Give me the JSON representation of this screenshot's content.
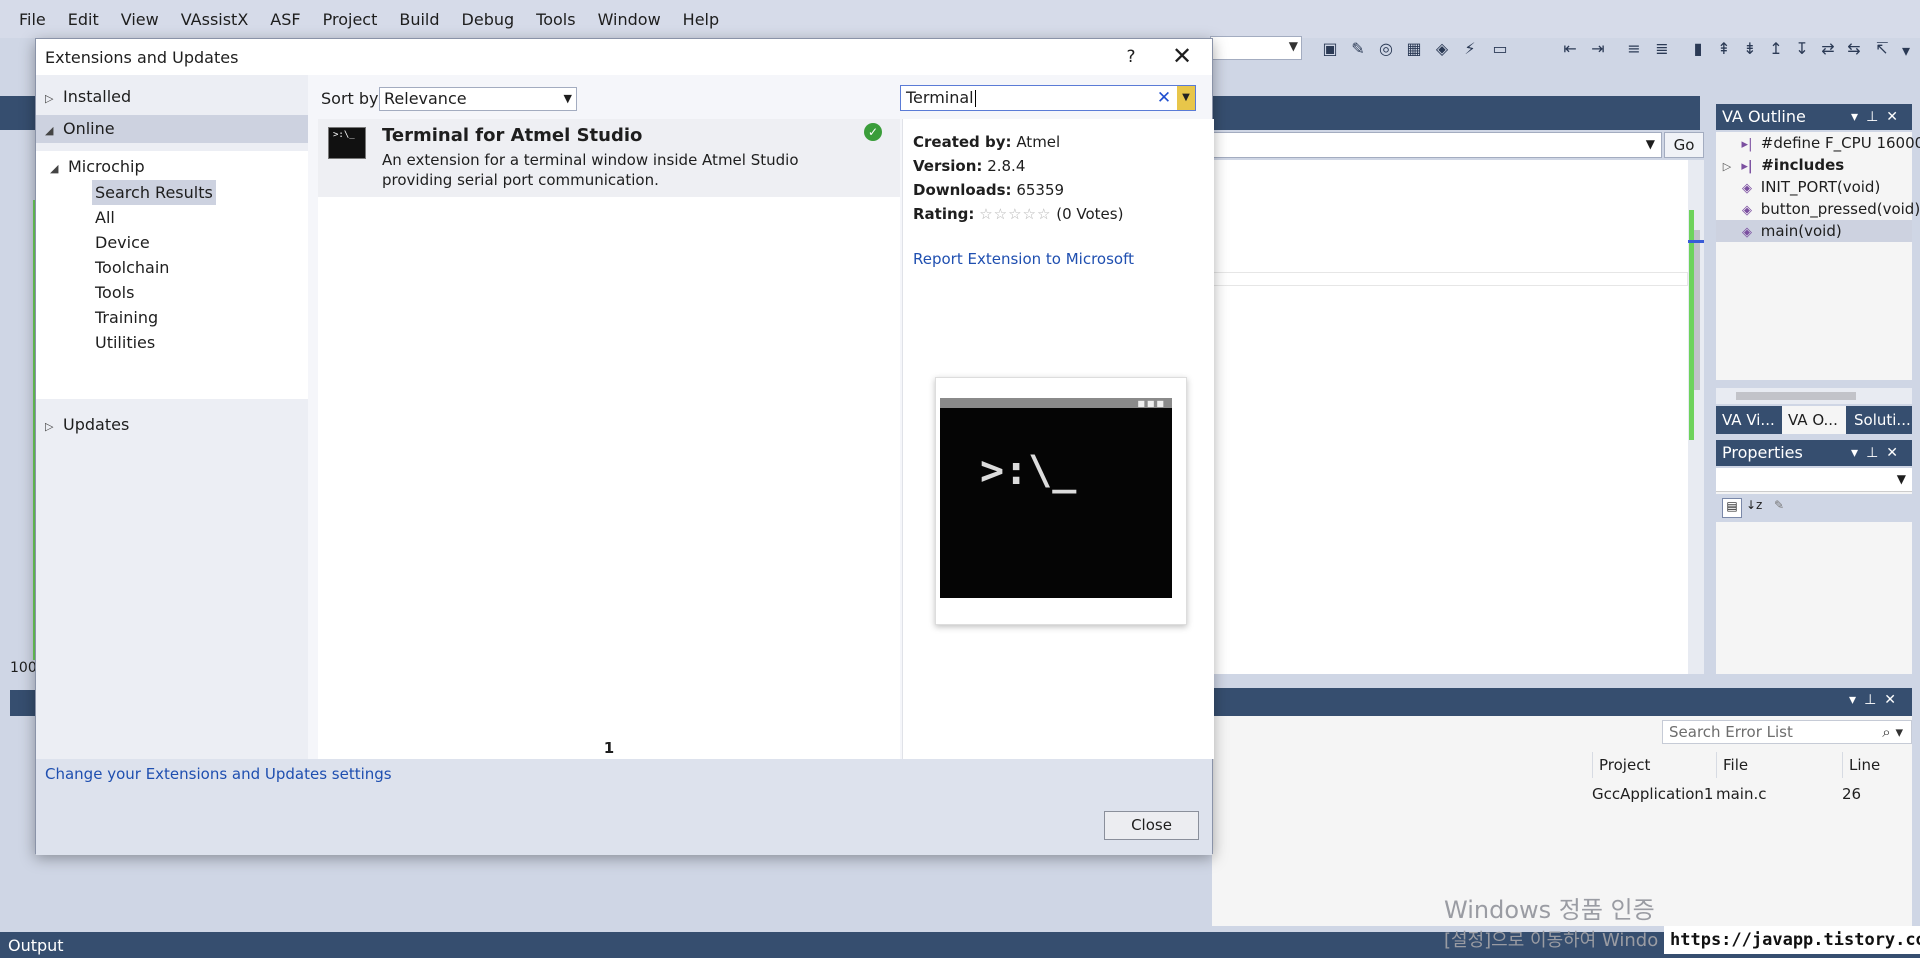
{
  "menu": [
    "File",
    "Edit",
    "View",
    "VAssistX",
    "ASF",
    "Project",
    "Build",
    "Debug",
    "Tools",
    "Window",
    "Help"
  ],
  "editor": {
    "go_label": "Go",
    "zoom": "100"
  },
  "va_outline": {
    "title": "VA Outline",
    "items": [
      "#define F_CPU 16000",
      "#includes",
      "INIT_PORT(void)",
      "button_pressed(void)",
      "main(void)"
    ],
    "tabs": [
      "VA Vi...",
      "VA O...",
      "Soluti..."
    ]
  },
  "properties": {
    "title": "Properties"
  },
  "error_list": {
    "search_placeholder": "Search Error List",
    "columns": [
      "Project",
      "File",
      "Line"
    ],
    "row": [
      "GccApplication1",
      "main.c",
      "26"
    ]
  },
  "output_label": "Output",
  "watermark": {
    "line1": "Windows 정품 인증",
    "line2": "[설정]으로 이동하여 Windo"
  },
  "blog_url": "https://javapp.tistory.com/",
  "dialog": {
    "title": "Extensions and Updates",
    "help": "?",
    "nav": {
      "installed": "Installed",
      "online": "Online",
      "microchip": "Microchip",
      "items": [
        "Search Results",
        "All",
        "Device",
        "Toolchain",
        "Tools",
        "Training",
        "Utilities"
      ],
      "updates": "Updates"
    },
    "sort_label": "Sort by:",
    "sort_value": "Relevance",
    "search_value": "Terminal",
    "result": {
      "name": "Terminal for Atmel Studio",
      "description": "An extension for a terminal window inside Atmel Studio providing serial port communication."
    },
    "page_number": "1",
    "details": {
      "created_by_label": "Created by:",
      "created_by": "Atmel",
      "version_label": "Version:",
      "version": "2.8.4",
      "downloads_label": "Downloads:",
      "downloads": "65359",
      "rating_label": "Rating:",
      "votes": "(0 Votes)",
      "report_link": "Report Extension to Microsoft"
    },
    "settings_link": "Change your Extensions and Updates settings",
    "close_label": "Close"
  }
}
